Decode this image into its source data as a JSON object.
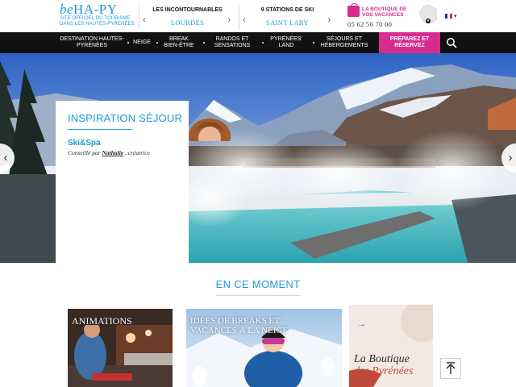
{
  "header": {
    "logo_main": "beHA-PY",
    "logo_be": "be",
    "logo_rest": "HA-PY",
    "logo_sub_line1": "SITE OFFICIEL DU TOURISME",
    "logo_sub_line2": "DANS LES HAUTES-PYRÉNÉES",
    "selector1": {
      "label": "LES INCONTOURNABLES",
      "value": "LOURDES"
    },
    "selector2": {
      "label": "9 STATIONS DE SKI",
      "value": "SAINT LARY"
    },
    "shop_line1": "LA BOUTIQUE DE",
    "shop_line2": "VOS VACANCES",
    "phone": "05 62 56 70 00",
    "lang": "▾",
    "icons": {
      "shop": "shopping-bag-icon",
      "map": "france-map-icon",
      "flag": "french-flag-icon",
      "search": "search-icon"
    },
    "accent": "#d62c8c",
    "brand": "#1e9ad6"
  },
  "nav": {
    "items": [
      {
        "line1": "DESTINATION HAUTES-",
        "line2": "PYRÉNÉES"
      },
      {
        "line1": "NEIGE",
        "line2": ""
      },
      {
        "line1": "BREAK",
        "line2": "BIEN-ÊTRE"
      },
      {
        "line1": "RANDOS ET",
        "line2": "SENSATIONS"
      },
      {
        "line1": "PYRÉNÉES'",
        "line2": "LAND"
      },
      {
        "line1": "SÉJOURS ET",
        "line2": "HÉBERGEMENTS"
      }
    ],
    "cta_line1": "PRÉPAREZ ET",
    "cta_line2": "RÉSERVEZ"
  },
  "hero": {
    "card_title": "INSPIRATION SÉJOUR",
    "card_name": "Ski&Spa",
    "card_by_prefix": "Conseillé par ",
    "card_author": "Nathalie",
    "card_by_suffix": " , créatrice",
    "prev": "‹",
    "next": "›"
  },
  "moment": {
    "title": "EN CE MOMENT",
    "tiles": [
      {
        "caption": "ANIMATIONS",
        "arrow": "→"
      },
      {
        "caption_line1": "IDÉES DE BREAKS ET",
        "caption_line2": "VACANCES À LA NEIGE",
        "arrow": "→"
      },
      {
        "caption_line1": "La Boutique",
        "caption_line2": "des Pyrénées",
        "arrow": "→"
      }
    ]
  },
  "back_to_top": "↑"
}
